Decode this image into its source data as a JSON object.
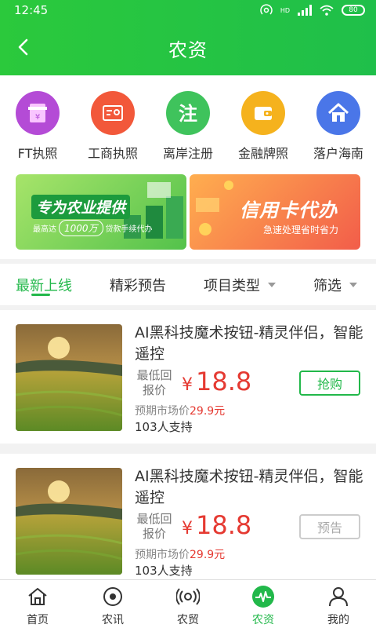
{
  "status": {
    "time": "12:45",
    "battery": "80",
    "network": "HD"
  },
  "navbar": {
    "title": "农资"
  },
  "categories": [
    {
      "label": "FT执照",
      "icon": "atm-icon",
      "color": "#b44bd6"
    },
    {
      "label": "工商执照",
      "icon": "license-card-icon",
      "color": "#f2583a"
    },
    {
      "label": "离岸注册",
      "icon": "register-icon",
      "color": "#3fc35c"
    },
    {
      "label": "金融牌照",
      "icon": "wallet-icon",
      "color": "#f5b21d"
    },
    {
      "label": "落户海南",
      "icon": "house-icon",
      "color": "#4a76e8"
    }
  ],
  "banners": {
    "left": {
      "title": "专为农业提供",
      "sub_prefix": "最高达",
      "amount": "1000万",
      "sub_suffix": "贷款手续代办"
    },
    "right": {
      "title": "信用卡代办",
      "sub": "急速处理省时省力"
    }
  },
  "tabs": [
    {
      "label": "最新上线",
      "active": true
    },
    {
      "label": "精彩预告",
      "active": false
    },
    {
      "label": "项目类型",
      "active": false
    },
    {
      "label": "筛选",
      "active": false
    }
  ],
  "products": [
    {
      "title": "AI黑科技魔术按钮-精灵伴侣，智能遥控",
      "price_label": "最低回报价",
      "currency": "¥",
      "price": "18.8",
      "market_label": "预期市场价",
      "market_price": "29.9元",
      "supporters": "103人支持",
      "button": "抢购"
    },
    {
      "title": "AI黑科技魔术按钮-精灵伴侣，智能遥控",
      "price_label": "最低回报价",
      "currency": "¥",
      "price": "18.8",
      "market_label": "预期市场价",
      "market_price": "29.9元",
      "supporters": "103人支持",
      "button": "预告"
    }
  ],
  "bottom_nav": [
    {
      "label": "首页",
      "icon": "home-icon"
    },
    {
      "label": "农讯",
      "icon": "news-icon"
    },
    {
      "label": "农贸",
      "icon": "trade-icon"
    },
    {
      "label": "农资",
      "icon": "supplies-icon",
      "active": true
    },
    {
      "label": "我的",
      "icon": "profile-icon"
    }
  ],
  "colors": {
    "brand": "#22b84a",
    "price": "#e53a32"
  }
}
